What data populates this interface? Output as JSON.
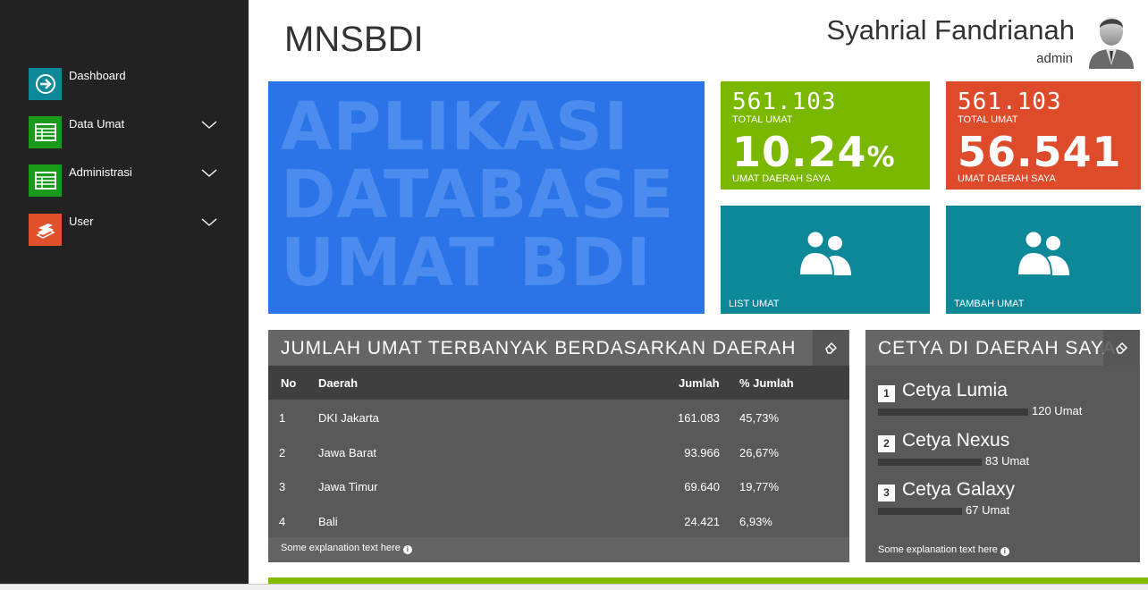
{
  "app": {
    "title": "MNSBDI"
  },
  "user": {
    "name": "Syahrial Fandrianah",
    "role": "admin"
  },
  "sidebar": {
    "items": [
      {
        "label": "Dashboard",
        "icon": "arrow-circle-icon",
        "color": "#0d8898"
      },
      {
        "label": "Data Umat",
        "icon": "table-icon",
        "color": "#1a9a1a"
      },
      {
        "label": "Administrasi",
        "icon": "table-icon",
        "color": "#1a9a1a"
      },
      {
        "label": "User",
        "icon": "books-icon",
        "color": "#e0502c"
      }
    ]
  },
  "hero": {
    "lines": [
      "APLIKASI",
      "DATABASE",
      "UMAT BDI"
    ],
    "color": "#2b74e8"
  },
  "stats": [
    {
      "top_value": "561.103",
      "top_caption": "TOTAL UMAT",
      "big_value": "10.24",
      "big_suffix": "%",
      "bottom_caption": "UMAT DAERAH SAYA",
      "color": "#7ab800"
    },
    {
      "top_value": "561.103",
      "top_caption": "TOTAL UMAT",
      "big_value": "56.541",
      "big_suffix": "",
      "bottom_caption": "UMAT DAERAH SAYA",
      "color": "#dd4b2a"
    }
  ],
  "actions": [
    {
      "label": "LIST UMAT",
      "icon": "users-icon"
    },
    {
      "label": "TAMBAH UMAT",
      "icon": "users-icon"
    }
  ],
  "region_panel": {
    "title": "JUMLAH UMAT TERBANYAK BERDASARKAN DAERAH",
    "columns": [
      "No",
      "Daerah",
      "Jumlah",
      "% Jumlah"
    ],
    "rows": [
      {
        "no": "1",
        "daerah": "DKI Jakarta",
        "jumlah": "161.083",
        "persen": "45,73%"
      },
      {
        "no": "2",
        "daerah": "Jawa Barat",
        "jumlah": "93.966",
        "persen": "26,67%"
      },
      {
        "no": "3",
        "daerah": "Jawa Timur",
        "jumlah": "69.640",
        "persen": "19,77%"
      },
      {
        "no": "4",
        "daerah": "Bali",
        "jumlah": "24.421",
        "persen": "6,93%"
      }
    ],
    "footnote": "Some explanation text here"
  },
  "cetya_panel": {
    "title": "CETYA DI DAERAH SAYA",
    "items": [
      {
        "rank": "1",
        "name": "Cetya Lumia",
        "count": "120 Umat",
        "value": 120
      },
      {
        "rank": "2",
        "name": "Cetya Nexus",
        "count": "83 Umat",
        "value": 83
      },
      {
        "rank": "3",
        "name": "Cetya Galaxy",
        "count": "67 Umat",
        "value": 67
      }
    ],
    "footnote": "Some explanation text here"
  }
}
